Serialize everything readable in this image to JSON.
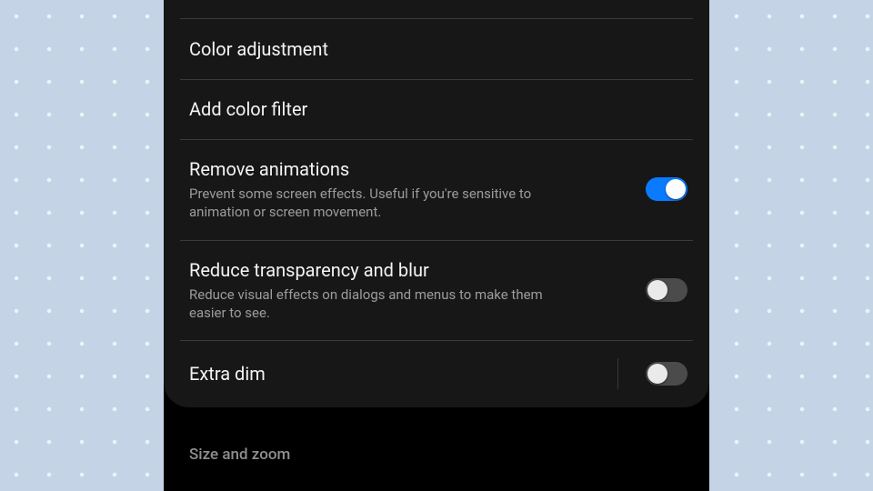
{
  "settings": {
    "items": [
      {
        "title": "Color adjustment"
      },
      {
        "title": "Add color filter"
      },
      {
        "title": "Remove animations",
        "subtitle": "Prevent some screen effects. Useful if you're sensitive to animation or screen movement.",
        "toggle": true
      },
      {
        "title": "Reduce transparency and blur",
        "subtitle": "Reduce visual effects on dialogs and menus to make them easier to see.",
        "toggle": false
      },
      {
        "title": "Extra dim",
        "toggle": false,
        "separated": true
      }
    ],
    "next_section_header": "Size and zoom"
  }
}
